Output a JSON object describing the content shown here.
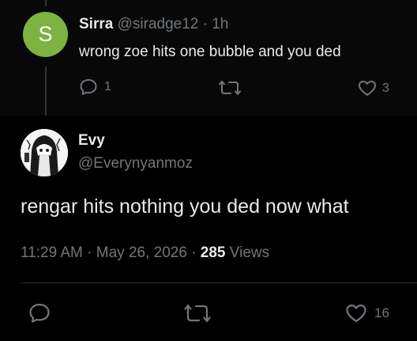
{
  "reply": {
    "avatar_letter": "S",
    "avatar_color": "#7cb342",
    "name": "Sirra",
    "handle": "@siradge12",
    "separator": "·",
    "time": "1h",
    "text": "wrong zoe hits one bubble and you ded",
    "reply_count": "1",
    "like_count": "3"
  },
  "post": {
    "name": "Evy",
    "handle": "@Everynyanmoz",
    "text": "rengar hits nothing you ded now what",
    "time": "11:29 AM",
    "date_separator": "·",
    "date": "May 26, 2026",
    "views_separator": "·",
    "views_count": "285",
    "views_label": "Views",
    "like_count": "16"
  },
  "colors": {
    "background": "#000000",
    "reply_background": "#080808",
    "text": "#e7e9ea",
    "muted": "#71767b",
    "divider": "#2f3336"
  },
  "icons": {
    "reply": "speech-bubble-icon",
    "repost": "repost-arrows-icon",
    "like": "heart-icon"
  }
}
